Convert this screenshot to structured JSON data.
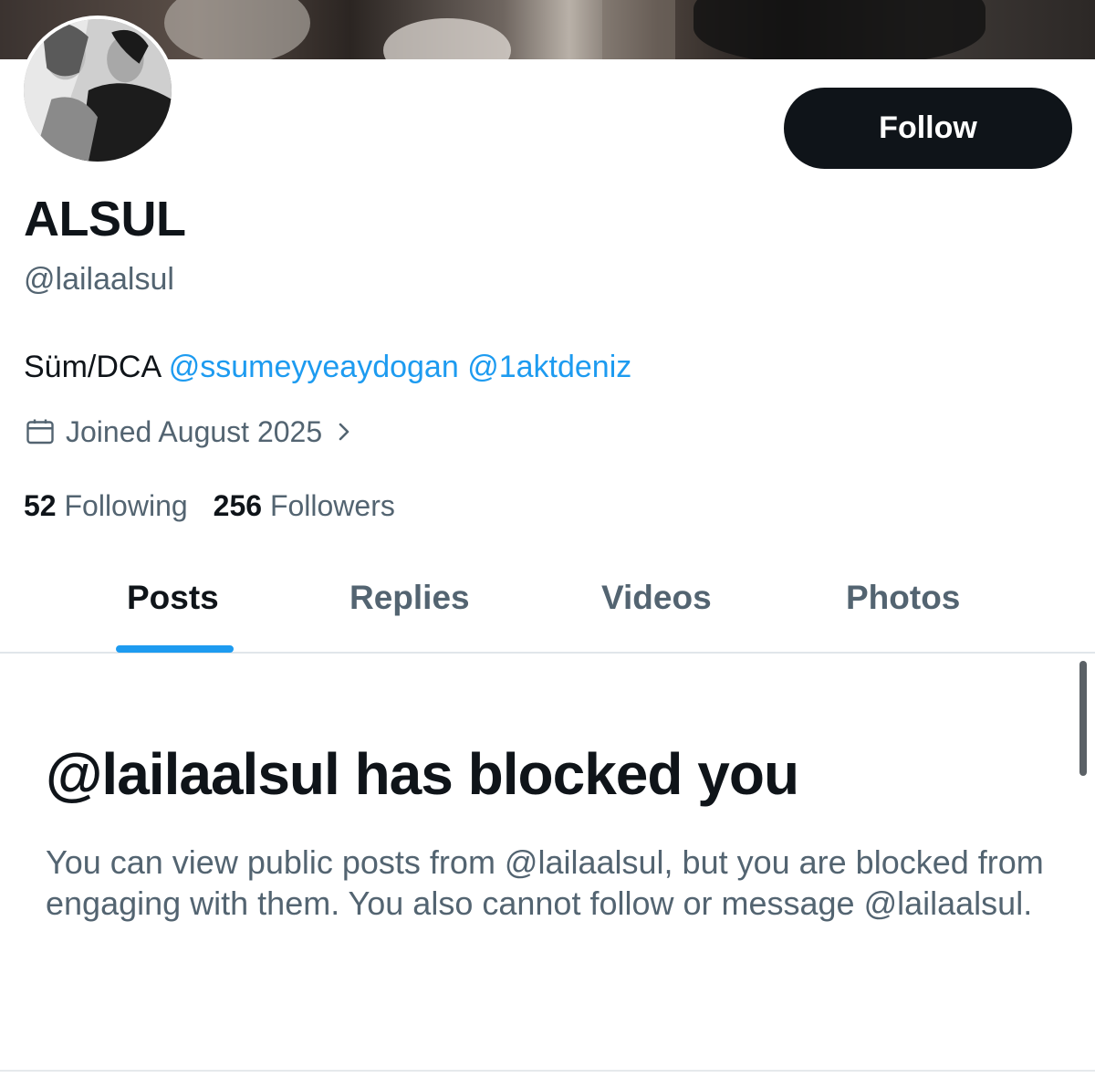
{
  "profile": {
    "display_name": "ALSUL",
    "handle": "@lailaalsul",
    "bio_text": "Süm/DCA ",
    "bio_mentions": [
      "@ssumeyyeaydogan",
      "@1aktdeniz"
    ],
    "joined": "Joined August 2025",
    "following_count": "52",
    "following_label": "Following",
    "followers_count": "256",
    "followers_label": "Followers"
  },
  "actions": {
    "follow_label": "Follow"
  },
  "tabs": [
    {
      "label": "Posts",
      "active": true
    },
    {
      "label": "Replies",
      "active": false
    },
    {
      "label": "Videos",
      "active": false
    },
    {
      "label": "Photos",
      "active": false
    }
  ],
  "blocked": {
    "title": "@lailaalsul has blocked you",
    "description": "You can view public posts from @lailaalsul, but you are blocked from engaging with them. You also cannot follow or message @lailaalsul."
  },
  "colors": {
    "accent": "#1d9bf0",
    "text_primary": "#0f1419",
    "text_secondary": "#536471",
    "button_bg": "#0f1419"
  },
  "icons": {
    "calendar": "calendar-icon",
    "chevron": "chevron-right-icon"
  }
}
